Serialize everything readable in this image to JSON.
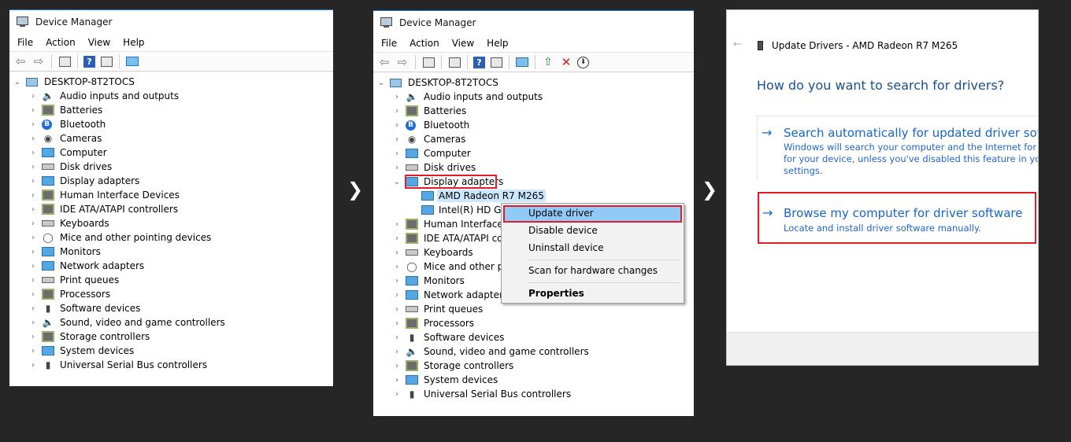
{
  "device_manager": {
    "title": "Device Manager",
    "menu": [
      "File",
      "Action",
      "View",
      "Help"
    ],
    "root": "DESKTOP-8T2TOCS",
    "categories": [
      {
        "label": "Audio inputs and outputs",
        "icon": "speaker-icon"
      },
      {
        "label": "Batteries",
        "icon": "battery-icon"
      },
      {
        "label": "Bluetooth",
        "icon": "bluetooth-icon"
      },
      {
        "label": "Cameras",
        "icon": "camera-icon"
      },
      {
        "label": "Computer",
        "icon": "computer-icon"
      },
      {
        "label": "Disk drives",
        "icon": "disk-drive-icon"
      },
      {
        "label": "Display adapters",
        "icon": "display-adapter-icon"
      },
      {
        "label": "Human Interface Devices",
        "icon": "hid-icon"
      },
      {
        "label": "IDE ATA/ATAPI controllers",
        "icon": "ide-controller-icon"
      },
      {
        "label": "Keyboards",
        "icon": "keyboard-icon"
      },
      {
        "label": "Mice and other pointing devices",
        "icon": "mouse-icon"
      },
      {
        "label": "Monitors",
        "icon": "monitor-icon"
      },
      {
        "label": "Network adapters",
        "icon": "network-adapter-icon"
      },
      {
        "label": "Print queues",
        "icon": "printer-icon"
      },
      {
        "label": "Processors",
        "icon": "processor-icon"
      },
      {
        "label": "Software devices",
        "icon": "software-device-icon"
      },
      {
        "label": "Sound, video and game controllers",
        "icon": "sound-icon"
      },
      {
        "label": "Storage controllers",
        "icon": "storage-icon"
      },
      {
        "label": "System devices",
        "icon": "system-device-icon"
      },
      {
        "label": "Universal Serial Bus controllers",
        "icon": "usb-icon"
      }
    ],
    "display_children": [
      "AMD Radeon R7 M265",
      "Intel(R) HD Gra"
    ],
    "truncated": {
      "hid": "Human Interface D",
      "ide": "IDE ATA/ATAPI cor",
      "mice": "Mice and other po"
    }
  },
  "context_menu": {
    "items": [
      "Update driver",
      "Disable device",
      "Uninstall device",
      "Scan for hardware changes",
      "Properties"
    ]
  },
  "update_drivers": {
    "header": "Update Drivers - AMD Radeon R7 M265",
    "question": "How do you want to search for drivers?",
    "option_auto": {
      "title": "Search automatically for updated driver softwa",
      "desc": [
        "Windows will search your computer and the Internet for the la",
        "for your device, unless you've disabled this feature in your dev",
        "settings."
      ]
    },
    "option_browse": {
      "title": "Browse my computer for driver software",
      "desc": "Locate and install driver software manually."
    }
  }
}
